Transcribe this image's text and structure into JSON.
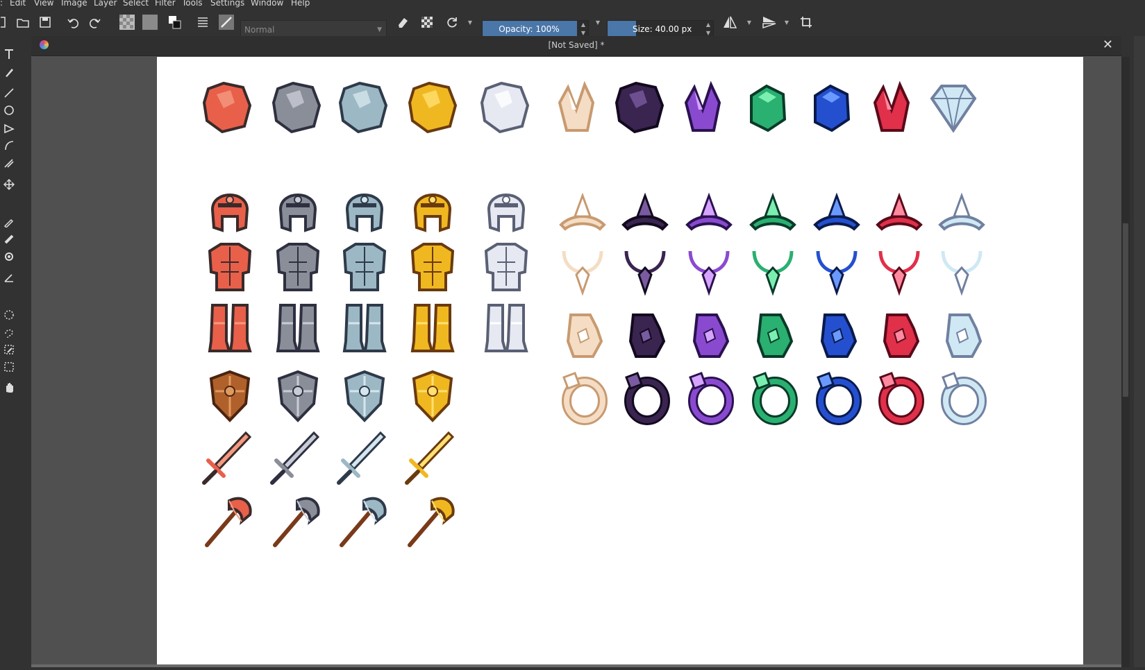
{
  "menu": {
    "items": [
      "Edit",
      "View",
      "Image",
      "Layer",
      "Select",
      "Filter",
      "Tools",
      "Settings",
      "Window",
      "Help"
    ]
  },
  "toolbar": {
    "blend_mode": "Normal",
    "opacity_label": "Opacity: 100%",
    "opacity_value": 1.0,
    "size_label": "Size: 40.00 px",
    "size_value": 0.3
  },
  "document": {
    "title": "[Not Saved]  *",
    "close_glyph": "✕"
  },
  "colors": {
    "accent": "#4a76a8",
    "panel": "#323232",
    "canvas_bg": "#505050",
    "paper": "#ffffff"
  },
  "assets": {
    "gems": [
      "red-ore-icon",
      "iron-ore-icon",
      "silver-ore-icon",
      "gold-ore-icon",
      "white-ore-icon",
      "quartz-crystal-icon",
      "obsidian-icon",
      "amethyst-cluster-icon",
      "emerald-icon",
      "sapphire-icon",
      "ruby-crystal-icon",
      "diamond-icon"
    ],
    "armor_helmets": [
      "copper-helmet-icon",
      "iron-helmet-icon",
      "steel-helmet-icon",
      "gold-helmet-icon",
      "mithril-helmet-icon"
    ],
    "armor_chest": [
      "copper-chestplate-icon",
      "iron-chestplate-icon",
      "steel-chestplate-icon",
      "gold-chestplate-icon",
      "mithril-chestplate-icon"
    ],
    "armor_boots": [
      "copper-boots-icon",
      "iron-boots-icon",
      "steel-boots-icon",
      "gold-boots-icon",
      "mithril-boots-icon"
    ],
    "shields": [
      "wooden-shield-icon",
      "iron-shield-icon",
      "steel-shield-icon",
      "gold-shield-icon"
    ],
    "swords": [
      "copper-sword-icon",
      "iron-sword-icon",
      "steel-sword-icon",
      "gold-sword-icon"
    ],
    "axes": [
      "copper-axe-icon",
      "iron-axe-icon",
      "steel-axe-icon",
      "gold-axe-icon"
    ],
    "tiaras": [
      "quartz-tiara-icon",
      "obsidian-tiara-icon",
      "amethyst-tiara-icon",
      "emerald-tiara-icon",
      "sapphire-tiara-icon",
      "ruby-tiara-icon",
      "diamond-tiara-icon"
    ],
    "necklaces": [
      "quartz-necklace-icon",
      "obsidian-necklace-icon",
      "amethyst-necklace-icon",
      "emerald-necklace-icon",
      "sapphire-necklace-icon",
      "ruby-necklace-icon",
      "diamond-necklace-icon"
    ],
    "gloves": [
      "quartz-glove-icon",
      "obsidian-glove-icon",
      "amethyst-glove-icon",
      "emerald-glove-icon",
      "sapphire-glove-icon",
      "ruby-glove-icon",
      "diamond-glove-icon"
    ],
    "rings": [
      "quartz-ring-icon",
      "obsidian-ring-icon",
      "amethyst-ring-icon",
      "emerald-ring-icon",
      "sapphire-ring-icon",
      "ruby-ring-icon",
      "diamond-ring-icon"
    ]
  }
}
